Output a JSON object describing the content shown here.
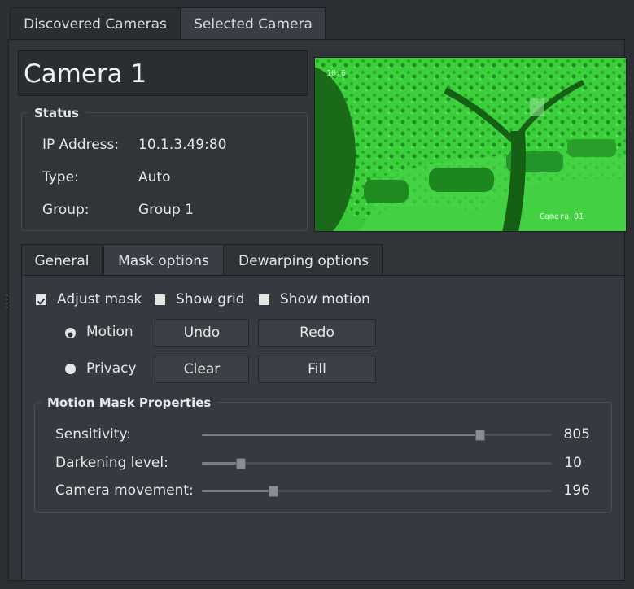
{
  "tabs": {
    "discovered": "Discovered Cameras",
    "selected": "Selected Camera"
  },
  "camera": {
    "name": "Camera 1",
    "status": {
      "title": "Status",
      "ip_label": "IP Address:",
      "ip_value": "10.1.3.49:80",
      "type_label": "Type:",
      "type_value": "Auto",
      "group_label": "Group:",
      "group_value": "Group 1"
    },
    "overlay": {
      "camera_label": "Camera 01",
      "timestamp": "10:6"
    }
  },
  "subtabs": {
    "general": "General",
    "mask": "Mask options",
    "dewarping": "Dewarping options"
  },
  "mask": {
    "adjust_mask": {
      "label": "Adjust mask",
      "checked": true
    },
    "show_grid": {
      "label": "Show grid",
      "checked": false
    },
    "show_motion": {
      "label": "Show motion",
      "checked": false
    },
    "radio_motion": {
      "label": "Motion",
      "selected": true
    },
    "radio_privacy": {
      "label": "Privacy",
      "selected": false
    },
    "undo": "Undo",
    "redo": "Redo",
    "clear": "Clear",
    "fill": "Fill"
  },
  "motion_props": {
    "title": "Motion Mask Properties",
    "sensitivity": {
      "label": "Sensitivity:",
      "value": "805",
      "fraction": 0.805
    },
    "darkening": {
      "label": "Darkening level:",
      "value": "10",
      "fraction": 0.1
    },
    "movement": {
      "label": "Camera movement:",
      "value": "196",
      "fraction": 0.196
    }
  },
  "colors": {
    "night_vision_green": "#2fbf2f",
    "panel_bg": "#31353a",
    "window_bg": "#2b2e33"
  }
}
